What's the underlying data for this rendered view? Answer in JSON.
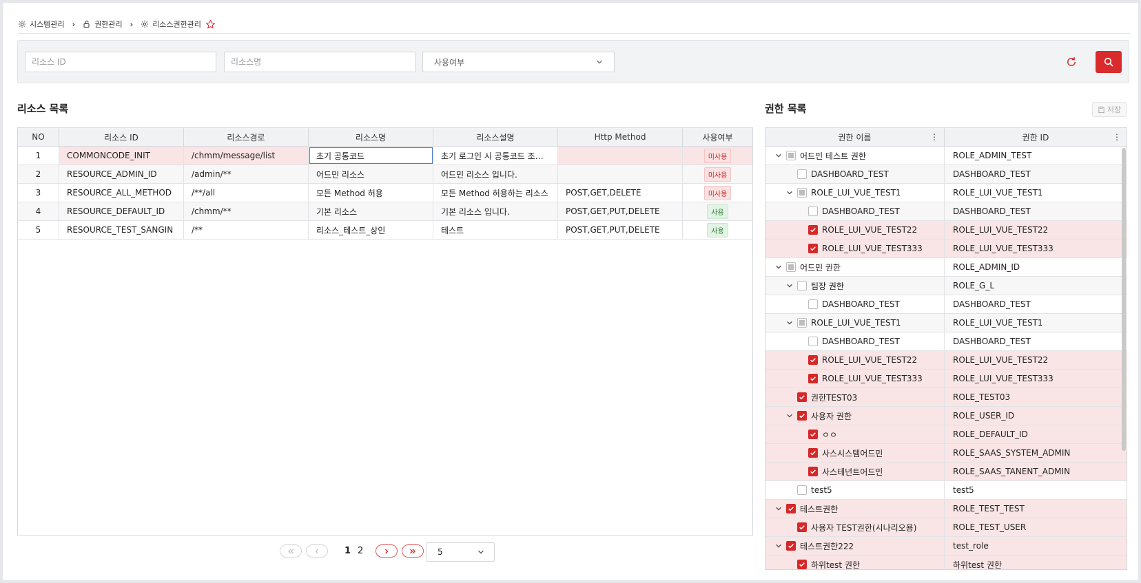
{
  "breadcrumb": {
    "items": [
      "시스템관리",
      "권한관리",
      "리소스권한관리"
    ]
  },
  "search": {
    "resource_id_placeholder": "리소스 ID",
    "resource_name_placeholder": "리소스명",
    "use_select_value": "사용여부"
  },
  "resource_list": {
    "title": "리소스 목록",
    "columns": [
      "NO",
      "리소스 ID",
      "리소스경로",
      "리소스명",
      "리소스설명",
      "Http Method",
      "사용여부"
    ],
    "rows": [
      {
        "no": "1",
        "id": "COMMONCODE_INIT",
        "path": "/chmm/message/list",
        "name": "초기 공통코드",
        "desc": "초기 로그인 시 공통코드 조회...",
        "method": "",
        "use": "미사용"
      },
      {
        "no": "2",
        "id": "RESOURCE_ADMIN_ID",
        "path": "/admin/**",
        "name": "어드민 리소스",
        "desc": "어드민 리소스 입니다.",
        "method": "",
        "use": "미사용"
      },
      {
        "no": "3",
        "id": "RESOURCE_ALL_METHOD",
        "path": "/**/all",
        "name": "모든 Method 허용",
        "desc": "모든 Method 허용하는 리소스",
        "method": "POST,GET,DELETE",
        "use": "미사용"
      },
      {
        "no": "4",
        "id": "RESOURCE_DEFAULT_ID",
        "path": "/chmm/**",
        "name": "기본 리소스",
        "desc": "기본 리소스 입니다.",
        "method": "POST,GET,PUT,DELETE",
        "use": "사용"
      },
      {
        "no": "5",
        "id": "RESOURCE_TEST_SANGIN",
        "path": "/**",
        "name": "리소스_테스트_상인",
        "desc": "테스트",
        "method": "POST,GET,PUT,DELETE",
        "use": "사용"
      }
    ]
  },
  "pagination": {
    "pages": [
      "1",
      "2"
    ],
    "current": "1",
    "page_size": "5"
  },
  "auth_list": {
    "title": "권한 목록",
    "save_label": "저장",
    "columns": [
      "권한 이름",
      "권한 ID"
    ],
    "rows": [
      {
        "name": "어드민 테스트 권한",
        "id": "ROLE_ADMIN_TEST",
        "level": 0,
        "expand": true,
        "check": "partial"
      },
      {
        "name": "DASHBOARD_TEST",
        "id": "DASHBOARD_TEST",
        "level": 1,
        "expand": false,
        "check": "off"
      },
      {
        "name": "ROLE_LUI_VUE_TEST1",
        "id": "ROLE_LUI_VUE_TEST1",
        "level": 1,
        "expand": true,
        "check": "partial"
      },
      {
        "name": "DASHBOARD_TEST",
        "id": "DASHBOARD_TEST",
        "level": 2,
        "expand": false,
        "check": "off"
      },
      {
        "name": "ROLE_LUI_VUE_TEST22",
        "id": "ROLE_LUI_VUE_TEST22",
        "level": 2,
        "expand": false,
        "check": "on"
      },
      {
        "name": "ROLE_LUI_VUE_TEST333",
        "id": "ROLE_LUI_VUE_TEST333",
        "level": 2,
        "expand": false,
        "check": "on"
      },
      {
        "name": "어드민 권한",
        "id": "ROLE_ADMIN_ID",
        "level": 0,
        "expand": true,
        "check": "partial"
      },
      {
        "name": "팀장 권한",
        "id": "ROLE_G_L",
        "level": 1,
        "expand": true,
        "check": "off"
      },
      {
        "name": "DASHBOARD_TEST",
        "id": "DASHBOARD_TEST",
        "level": 2,
        "expand": false,
        "check": "off"
      },
      {
        "name": "ROLE_LUI_VUE_TEST1",
        "id": "ROLE_LUI_VUE_TEST1",
        "level": 1,
        "expand": true,
        "check": "partial"
      },
      {
        "name": "DASHBOARD_TEST",
        "id": "DASHBOARD_TEST",
        "level": 2,
        "expand": false,
        "check": "off"
      },
      {
        "name": "ROLE_LUI_VUE_TEST22",
        "id": "ROLE_LUI_VUE_TEST22",
        "level": 2,
        "expand": false,
        "check": "on"
      },
      {
        "name": "ROLE_LUI_VUE_TEST333",
        "id": "ROLE_LUI_VUE_TEST333",
        "level": 2,
        "expand": false,
        "check": "on"
      },
      {
        "name": "권한TEST03",
        "id": "ROLE_TEST03",
        "level": 1,
        "expand": false,
        "check": "on"
      },
      {
        "name": "사용자 권한",
        "id": "ROLE_USER_ID",
        "level": 1,
        "expand": true,
        "check": "on"
      },
      {
        "name": "ㅇㅇ",
        "id": "ROLE_DEFAULT_ID",
        "level": 2,
        "expand": false,
        "check": "on"
      },
      {
        "name": "사스시스템어드민",
        "id": "ROLE_SAAS_SYSTEM_ADMIN",
        "level": 2,
        "expand": false,
        "check": "on"
      },
      {
        "name": "사스테넌트어드민",
        "id": "ROLE_SAAS_TANENT_ADMIN",
        "level": 2,
        "expand": false,
        "check": "on"
      },
      {
        "name": "test5",
        "id": "test5",
        "level": 1,
        "expand": false,
        "check": "off"
      },
      {
        "name": "테스트권한",
        "id": "ROLE_TEST_TEST",
        "level": 0,
        "expand": true,
        "check": "on"
      },
      {
        "name": "사용자 TEST권한(시나리오용)",
        "id": "ROLE_TEST_USER",
        "level": 1,
        "expand": false,
        "check": "on"
      },
      {
        "name": "테스트권한222",
        "id": "test_role",
        "level": 0,
        "expand": true,
        "check": "on"
      },
      {
        "name": "하위test 권한",
        "id": "하위test 권한",
        "level": 1,
        "expand": false,
        "check": "on"
      }
    ]
  },
  "colors": {
    "accent": "#d92b2b",
    "selected_row": "#f9e5e5",
    "badge_unused": "#c62828",
    "badge_used": "#2e7d32"
  }
}
